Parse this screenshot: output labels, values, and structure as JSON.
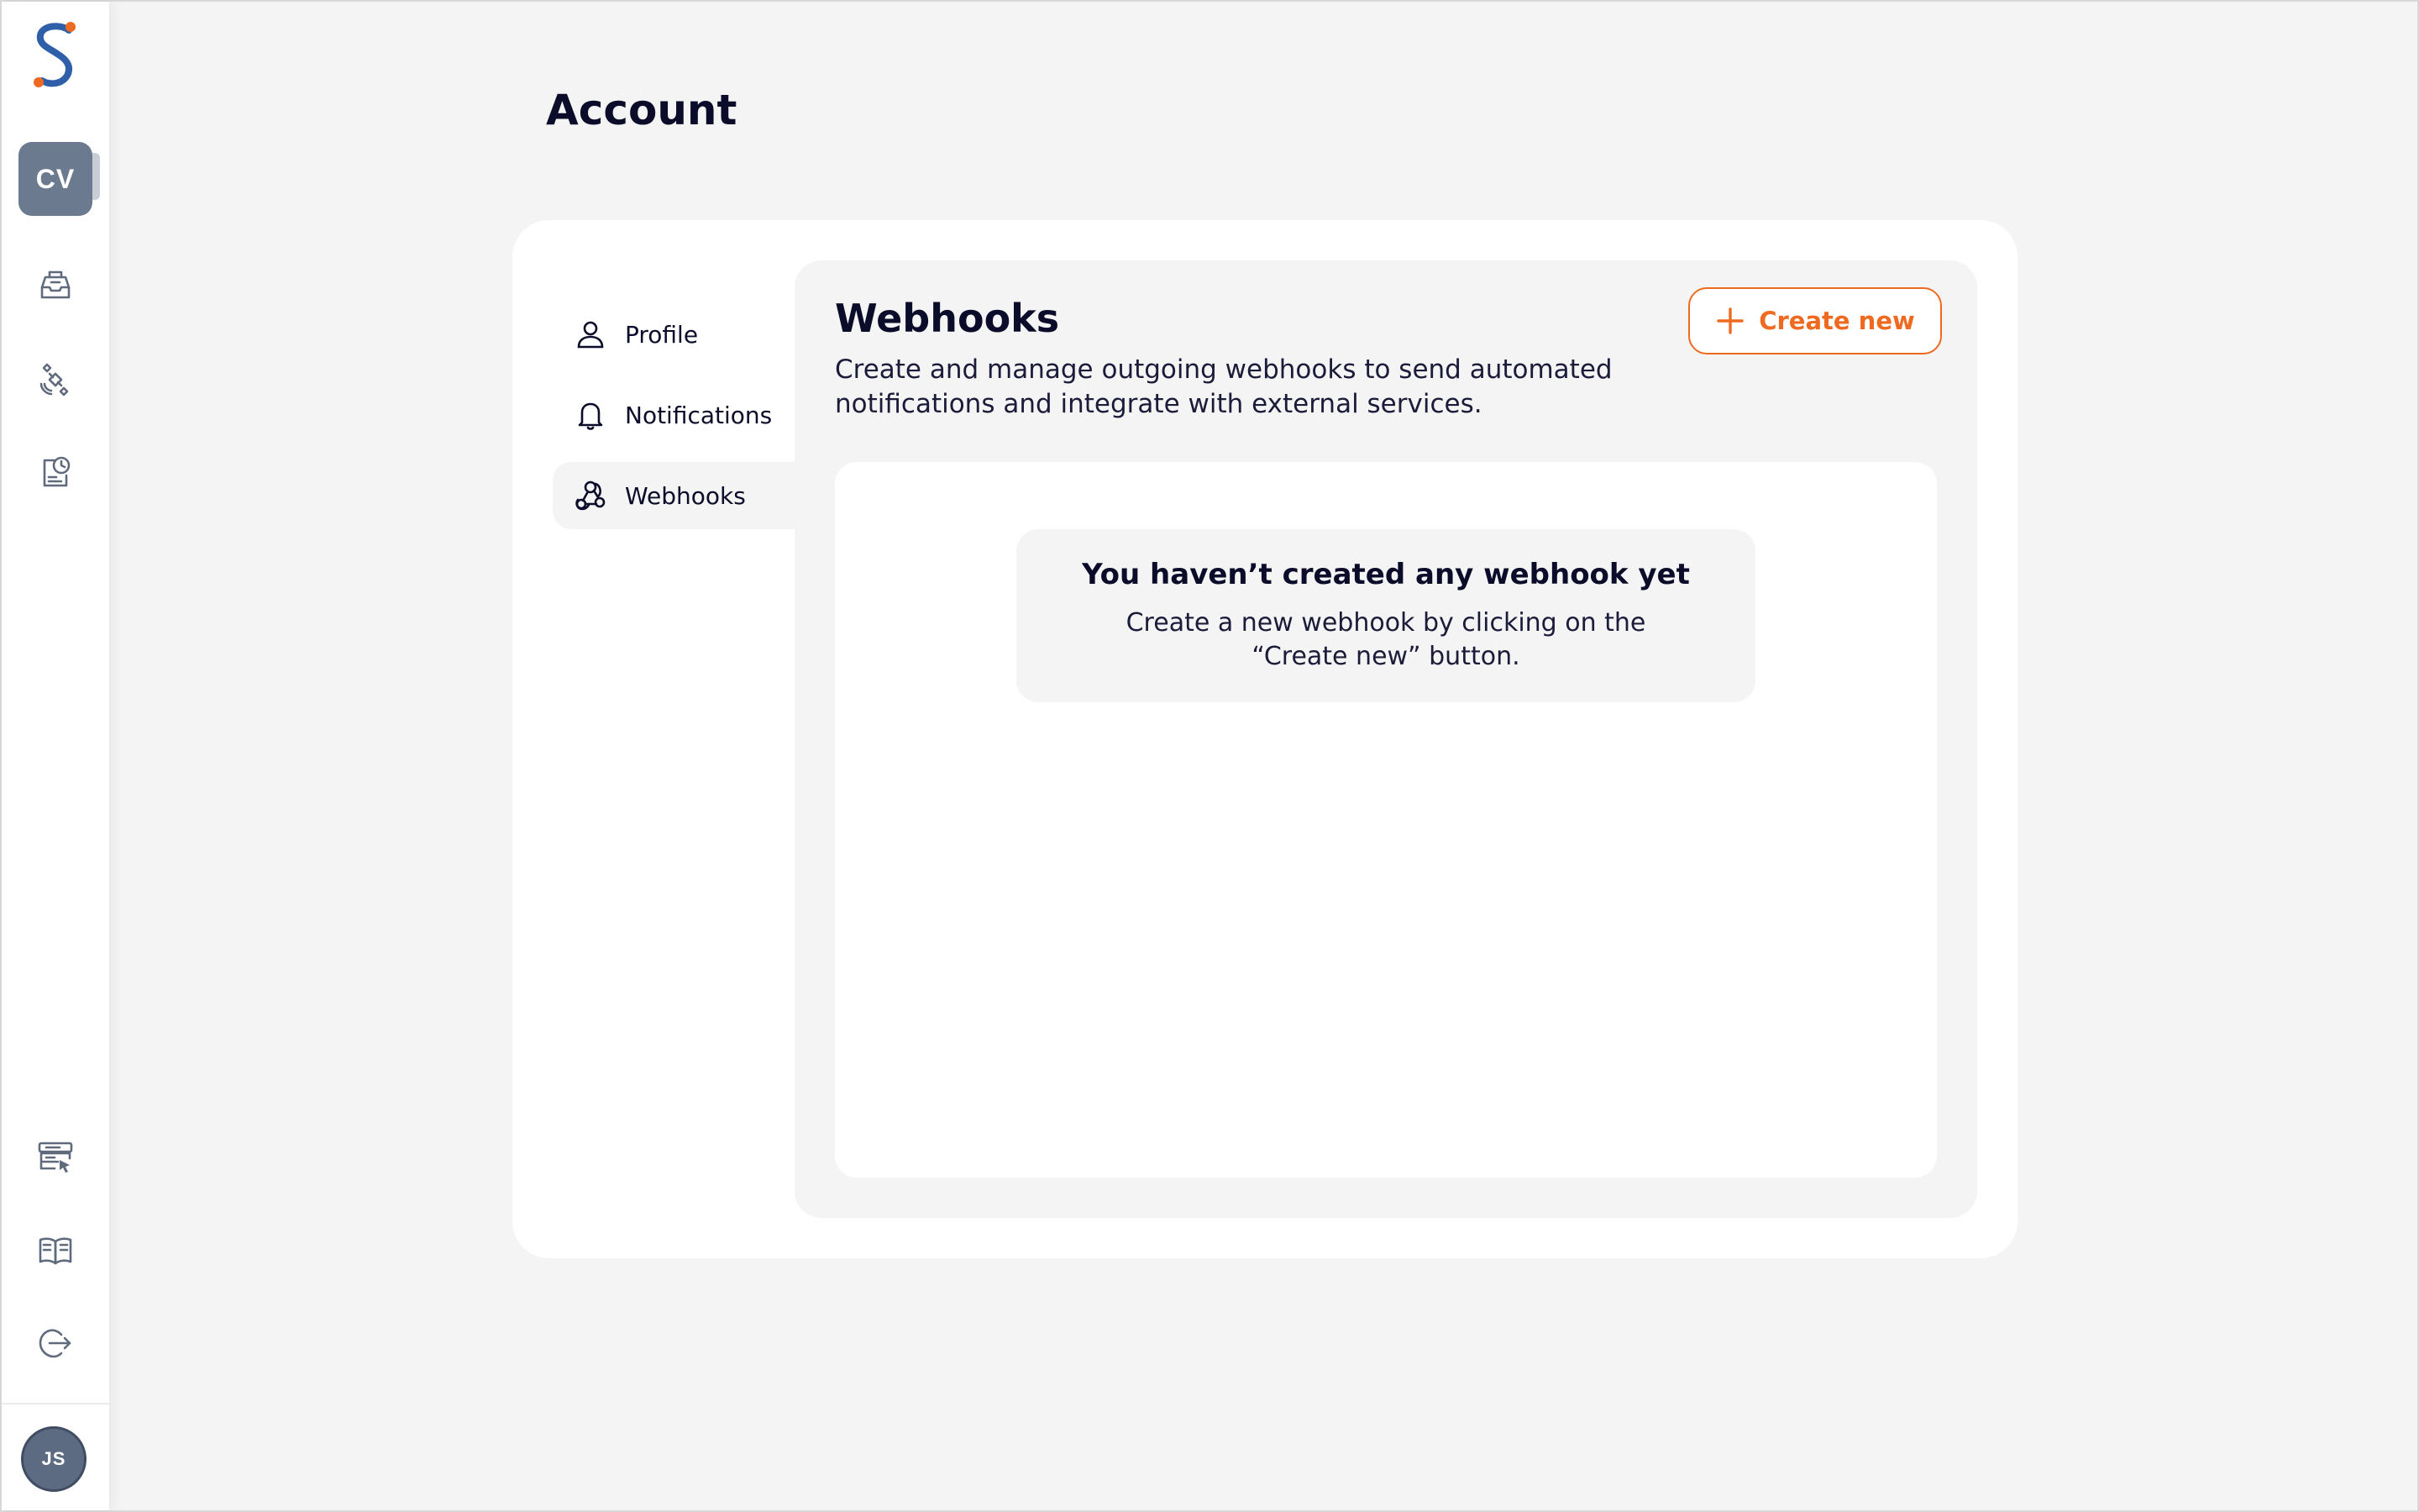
{
  "page": {
    "title": "Account"
  },
  "sidebar": {
    "team_badge": "CV",
    "user_avatar": "JS",
    "top_icons": [
      "inbox-icon",
      "satellite-icon",
      "scheduled-report-icon"
    ],
    "bottom_icons": [
      "workspace-select-icon",
      "docs-book-icon",
      "logout-icon"
    ]
  },
  "settings_menu": {
    "items": [
      {
        "label": "Profile",
        "icon": "user-icon",
        "active": false
      },
      {
        "label": "Notifications",
        "icon": "bell-icon",
        "active": false
      },
      {
        "label": "Webhooks",
        "icon": "webhook-icon",
        "active": true
      }
    ]
  },
  "webhooks": {
    "title": "Webhooks",
    "description": "Create and manage outgoing webhooks to send automated notifications and integrate with external services.",
    "create_button": "Create new",
    "empty_title": "You haven’t created any webhook yet",
    "empty_description": "Create a new webhook by clicking on the “Create new” button."
  },
  "colors": {
    "accent": "#ef6a21",
    "brand_blue": "#2f5fa8",
    "background": "#f4f4f4",
    "text_dark": "#0b0c2a",
    "badge": "#6c7a90"
  }
}
